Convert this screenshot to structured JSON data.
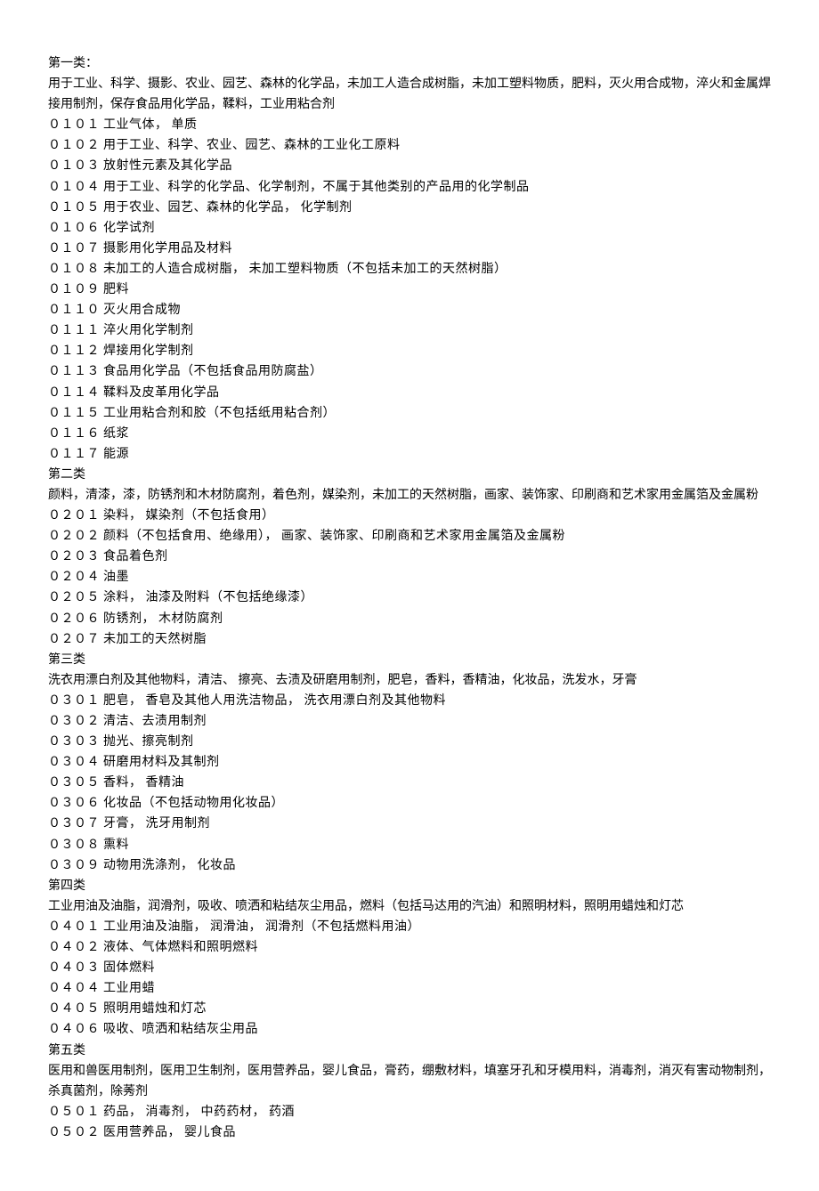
{
  "categories": [
    {
      "heading": "第一类：",
      "desc": "用于工业、科学、摄影、农业、园艺、森林的化学品，未加工人造合成树脂，未加工塑料物质，肥料，灭火用合成物，淬火和金属焊接用制剂，保存食品用化学品，鞣料，工业用粘合剂",
      "items": [
        "０１０１ 工业气体， 单质",
        "０１０２ 用于工业、科学、农业、园艺、森林的工业化工原料",
        "０１０３ 放射性元素及其化学品",
        "０１０４ 用于工业、科学的化学品、化学制剂，不属于其他类别的产品用的化学制品",
        "０１０５ 用于农业、园艺、森林的化学品， 化学制剂",
        "０１０６ 化学试剂",
        "０１０７ 摄影用化学用品及材料",
        "０１０８ 未加工的人造合成树脂， 未加工塑料物质（不包括未加工的天然树脂）",
        "０１０９ 肥料",
        "０１１０ 灭火用合成物",
        "０１１１ 淬火用化学制剂",
        "０１１２ 焊接用化学制剂",
        "０１１３ 食品用化学品（不包括食品用防腐盐）",
        "０１１４ 鞣料及皮革用化学品",
        "０１１５ 工业用粘合剂和胶（不包括纸用粘合剂）",
        "０１１６ 纸浆",
        "０１１７ 能源"
      ]
    },
    {
      "heading": "第二类",
      "desc": "颜料，清漆，漆，防锈剂和木材防腐剂，着色剂，媒染剂，未加工的天然树脂，画家、装饰家、印刷商和艺术家用金属箔及金属粉",
      "items": [
        "０２０１ 染料， 媒染剂（不包括食用）",
        "０２０２ 颜料（不包括食用、绝缘用）， 画家、装饰家、印刷商和艺术家用金属箔及金属粉",
        "０２０３ 食品着色剂",
        "０２０４ 油墨",
        "０２０５ 涂料， 油漆及附料（不包括绝缘漆）",
        "０２０６ 防锈剂， 木材防腐剂",
        "０２０７ 未加工的天然树脂"
      ]
    },
    {
      "heading": "第三类",
      "desc": "洗衣用漂白剂及其他物料，清洁、 擦亮、去渍及研磨用制剂，肥皂，香料，香精油，化妆品，洗发水，牙膏",
      "items": [
        "０３０１ 肥皂， 香皂及其他人用洗洁物品， 洗衣用漂白剂及其他物料",
        "０３０２ 清洁、去渍用制剂",
        "０３０３ 抛光、擦亮制剂",
        "０３０４ 研磨用材料及其制剂",
        "０３０５ 香料， 香精油",
        "０３０６ 化妆品（不包括动物用化妆品）",
        "０３０７ 牙膏， 洗牙用制剂",
        "０３０８ 熏料",
        "０３０９ 动物用洗涤剂， 化妆品"
      ]
    },
    {
      "heading": "第四类",
      "desc": "工业用油及油脂，润滑剂，吸收、喷洒和粘结灰尘用品，燃料（包括马达用的汽油）和照明材料，照明用蜡烛和灯芯",
      "items": [
        "０４０１ 工业用油及油脂， 润滑油， 润滑剂（不包括燃料用油）",
        "０４０２ 液体、气体燃料和照明燃料",
        "０４０３ 固体燃料",
        "０４０４ 工业用蜡",
        "０４０５ 照明用蜡烛和灯芯",
        "０４０６ 吸收、喷洒和粘结灰尘用品"
      ]
    },
    {
      "heading": "第五类",
      "desc": "医用和兽医用制剂，医用卫生制剂，医用营养品，婴儿食品，膏药，绷敷材料，填塞牙孔和牙模用料，消毒剂，消灭有害动物制剂，杀真菌剂，除莠剂",
      "items": [
        "０５０１ 药品， 消毒剂， 中药药材， 药酒",
        "０５０２ 医用营养品， 婴儿食品"
      ]
    }
  ]
}
